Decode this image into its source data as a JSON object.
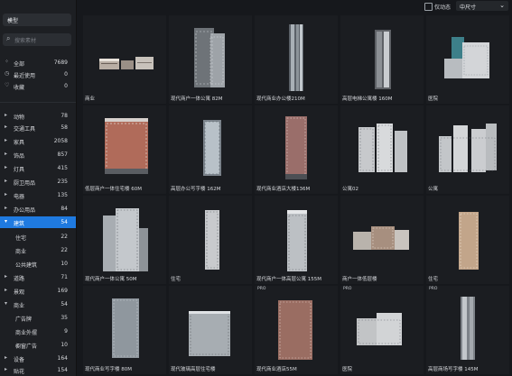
{
  "sidebar": {
    "model_select": {
      "value": "模型"
    },
    "search": {
      "placeholder": "搜索素材"
    },
    "quick": [
      {
        "icon": "grid-icon",
        "label": "全部",
        "count": "7689"
      },
      {
        "icon": "clock-icon",
        "label": "最近使用",
        "count": "0"
      },
      {
        "icon": "heart-icon",
        "label": "收藏",
        "count": "0"
      }
    ],
    "categories": [
      {
        "label": "动物",
        "count": "78"
      },
      {
        "label": "交通工具",
        "count": "58"
      },
      {
        "label": "家具",
        "count": "2058"
      },
      {
        "label": "饰品",
        "count": "857"
      },
      {
        "label": "灯具",
        "count": "415"
      },
      {
        "label": "厨卫用品",
        "count": "235"
      },
      {
        "label": "电器",
        "count": "135"
      },
      {
        "label": "办公用品",
        "count": "84"
      },
      {
        "label": "建筑",
        "count": "54"
      },
      {
        "label": "住宅",
        "count": "22"
      },
      {
        "label": "商业",
        "count": "22"
      },
      {
        "label": "公共建筑",
        "count": "10"
      },
      {
        "label": "道路",
        "count": "71"
      },
      {
        "label": "景观",
        "count": "169"
      },
      {
        "label": "商业",
        "count": "54"
      },
      {
        "label": "广告牌",
        "count": "35"
      },
      {
        "label": "商业外摆",
        "count": "9"
      },
      {
        "label": "橱窗广告",
        "count": "10"
      },
      {
        "label": "设备",
        "count": "164"
      },
      {
        "label": "贴花",
        "count": "154"
      }
    ]
  },
  "topbar": {
    "checkbox_label": "仅动态",
    "size_select": "中尺寸"
  },
  "grid": {
    "cards": [
      {
        "label": "商业",
        "pro": ""
      },
      {
        "label": "现代商户一体公寓 82M",
        "pro": ""
      },
      {
        "label": "现代商业办公楼210M",
        "pro": ""
      },
      {
        "label": "高层电梯公寓楼 160M",
        "pro": ""
      },
      {
        "label": "医院",
        "pro": ""
      },
      {
        "label": "低层商户一体住宅楼 60M",
        "pro": ""
      },
      {
        "label": "高层办公写字楼 162M",
        "pro": ""
      },
      {
        "label": "现代商业酒店大楼136M",
        "pro": ""
      },
      {
        "label": "公寓02",
        "pro": ""
      },
      {
        "label": "公寓",
        "pro": ""
      },
      {
        "label": "现代商户一体公寓 50M",
        "pro": ""
      },
      {
        "label": "住宅",
        "pro": ""
      },
      {
        "label": "现代商户一体高层公寓 155M",
        "pro": ""
      },
      {
        "label": "商户一体低层楼",
        "pro": ""
      },
      {
        "label": "住宅",
        "pro": ""
      },
      {
        "label": "现代商业写字楼 80M",
        "pro": ""
      },
      {
        "label": "现代玻璃高层住宅楼",
        "pro": ""
      },
      {
        "label": "现代商业酒店55M",
        "pro": "PRO"
      },
      {
        "label": "医院",
        "pro": "PRO"
      },
      {
        "label": "高层商场写字楼 145M",
        "pro": "PRO"
      }
    ]
  }
}
